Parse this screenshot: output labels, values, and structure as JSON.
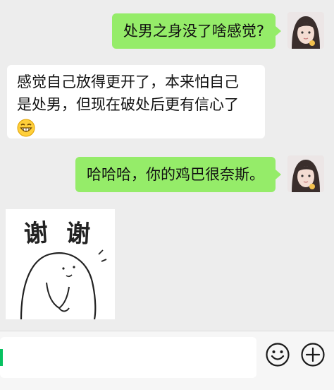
{
  "messages": [
    {
      "side": "out",
      "text": "处男之身没了啥感觉?"
    },
    {
      "side": "in",
      "lines": [
        "感觉自己放得更开了，本来怕自己",
        "是处男，但现在破处后更有信心了"
      ],
      "emoji": "grinning-face"
    },
    {
      "side": "out",
      "text": "哈哈哈，你的鸡巴很奈斯。"
    },
    {
      "side": "in",
      "type": "sticker",
      "sticker_text": [
        "谢",
        "谢"
      ]
    }
  ],
  "input_bar": {
    "value": "",
    "emoji_icon": "smiley-face-icon",
    "more_icon": "plus-circle-icon"
  },
  "colors": {
    "chat_background": "#ededed",
    "outgoing_bubble": "#95ec69",
    "incoming_bubble": "#ffffff",
    "cursor": "#07c160"
  }
}
